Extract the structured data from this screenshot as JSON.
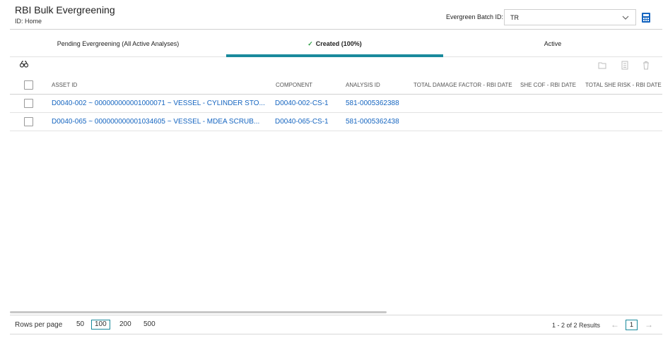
{
  "header": {
    "title": "RBI Bulk Evergreening",
    "subtitle": "ID: Home",
    "batch_label": "Evergreen Batch ID:",
    "batch_value": "TR"
  },
  "tabs": [
    {
      "label": "Pending Evergreening (All Active Analyses)"
    },
    {
      "label": "Created (100%)",
      "selected": true
    },
    {
      "label": "Active"
    }
  ],
  "toolbar": {
    "icons": [
      "binoculars-icon",
      "folder-icon",
      "calculator-icon",
      "trash-icon"
    ]
  },
  "table": {
    "columns": [
      "ASSET ID",
      "COMPONENT",
      "ANALYSIS ID",
      "TOTAL DAMAGE FACTOR - RBI DATE",
      "SHE COF - RBI DATE",
      "TOTAL SHE RISK - RBI DATE"
    ],
    "rows": [
      {
        "asset_id": "D0040-002 ~ 000000000001000071 ~ VESSEL - CYLINDER STO...",
        "component": "D0040-002-CS-1",
        "analysis_id": "581-0005362388"
      },
      {
        "asset_id": "D0040-065 ~ 000000000001034605 ~ VESSEL - MDEA SCRUB...",
        "component": "D0040-065-CS-1",
        "analysis_id": "581-0005362438"
      }
    ]
  },
  "footer": {
    "rows_per_page_label": "Rows per page",
    "options": [
      "50",
      "100",
      "200",
      "500"
    ],
    "selected_option": "100",
    "results": "1 - 2 of 2 Results",
    "prev_arrow": "←",
    "next_arrow": "→",
    "current_page": "1"
  },
  "colors": {
    "accent": "#1a8a9c",
    "link": "#1565c0",
    "check": "#2e9e44"
  }
}
